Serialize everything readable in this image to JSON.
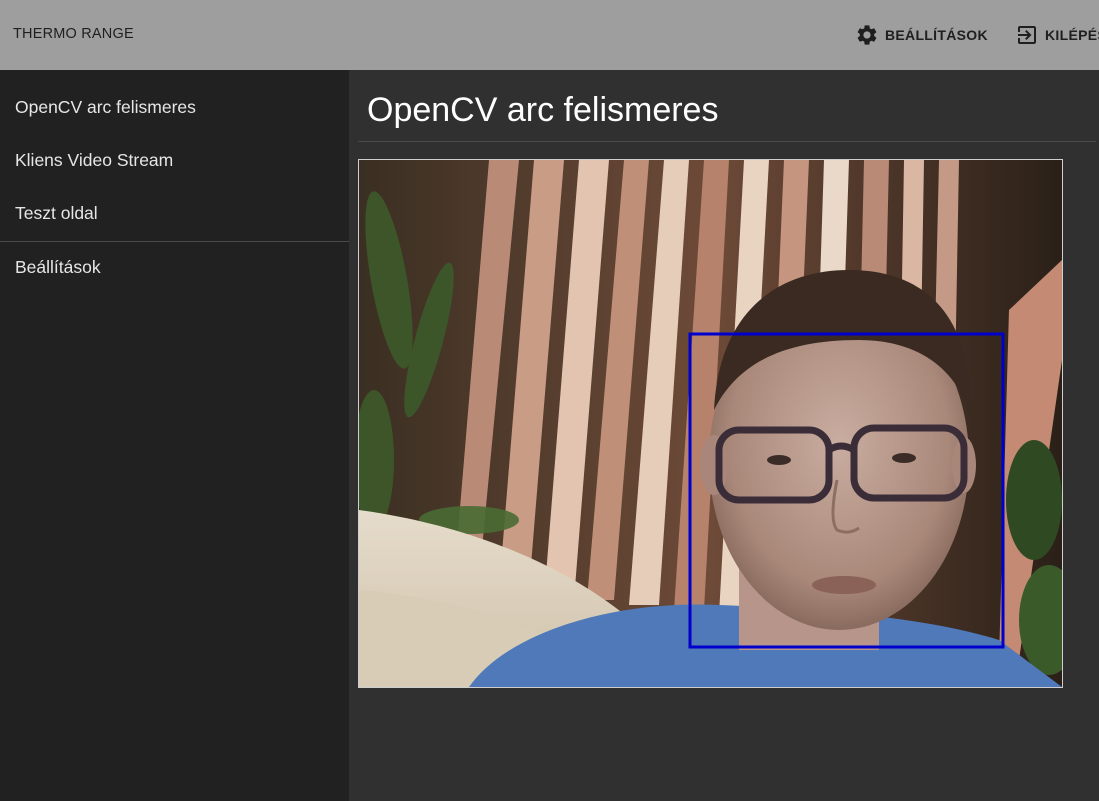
{
  "appbar": {
    "title": "THERMO RANGE",
    "settings_label": "BEÁLLÍTÁSOK",
    "settings_icon": "gear-icon",
    "logout_label": "KILÉPÉS",
    "logout_icon": "exit-icon",
    "background_color": "#9e9e9e"
  },
  "sidebar": {
    "items": [
      {
        "label": "OpenCV arc felismeres"
      },
      {
        "label": "Kliens Video Stream"
      },
      {
        "label": "Teszt oldal"
      },
      {
        "label": "Beállítások"
      }
    ]
  },
  "main": {
    "title": "OpenCV arc felismeres",
    "face_box_color": "#0000cc"
  }
}
